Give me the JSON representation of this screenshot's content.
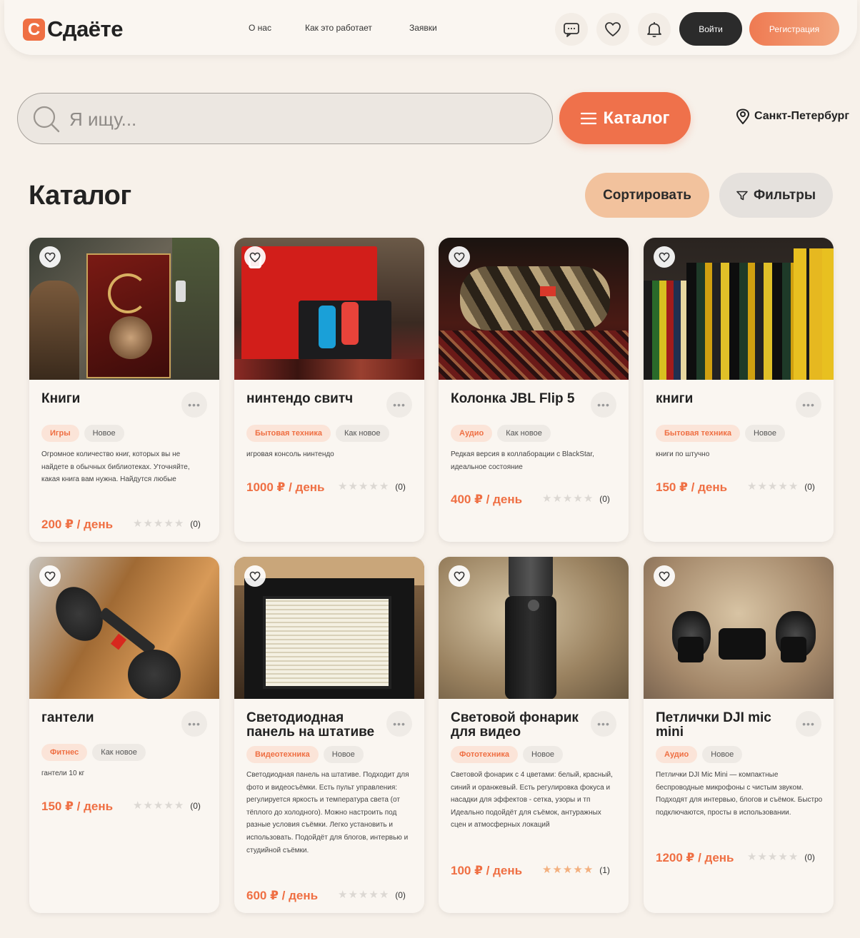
{
  "header": {
    "logo_mark": "С",
    "logo_text": "Сдаёте",
    "nav": [
      "О нас",
      "Как это работает",
      "Заявки"
    ],
    "login": "Войти",
    "register": "Регистрация"
  },
  "search": {
    "placeholder": "Я ищу...",
    "value": ""
  },
  "catalog_button": "Каталог",
  "location": "Санкт-Петербург",
  "page_title": "Каталог",
  "sort_button": "Сортировать",
  "filter_button": "Фильтры",
  "rating_max": 5,
  "cards": [
    {
      "title": "Книги",
      "category": "Игры",
      "condition": "Новое",
      "description": "Огромное количество книг, которых вы не найдете в обычных библиотеках. Уточняйте, какая книга вам нужна. Найдутся любые",
      "price": "200 ₽ / день",
      "rating": 0,
      "reviews": "(0)"
    },
    {
      "title": "нинтендо свитч",
      "category": "Бытовая техника",
      "condition": "Как новое",
      "description": "игровая консоль нинтендо",
      "price": "1000 ₽ / день",
      "rating": 0,
      "reviews": "(0)"
    },
    {
      "title": "Колонка JBL Flip 5",
      "category": "Аудио",
      "condition": "Как новое",
      "description": "Редкая версия в коллаборации с BlackStar, идеальное состояние",
      "price": "400 ₽ / день",
      "rating": 0,
      "reviews": "(0)"
    },
    {
      "title": "книги",
      "category": "Бытовая техника",
      "condition": "Новое",
      "description": "книги по штучно",
      "price": "150 ₽ / день",
      "rating": 0,
      "reviews": "(0)"
    },
    {
      "title": "гантели",
      "category": "Фитнес",
      "condition": "Как новое",
      "description": "гантели 10 кг",
      "price": "150 ₽ / день",
      "rating": 0,
      "reviews": "(0)"
    },
    {
      "title": "Светодиодная панель на штативе",
      "category": "Видеотехника",
      "condition": "Новое",
      "description": "Светодиодная панель на штативе. Подходит для фото и видеосъёмки. Есть пульт управления: регулируется яркость и температура света (от тёплого до холодного). Можно настроить под разные условия съёмки. Легко установить и использовать. Подойдёт для блогов, интервью и студийной съёмки.",
      "price": "600 ₽ / день",
      "rating": 0,
      "reviews": "(0)"
    },
    {
      "title": "Световой фонарик для видео",
      "category": "Фототехника",
      "condition": "Новое",
      "description": "Световой фонарик с 4 цветами: белый, красный, синий и оранжевый. Есть регулировка фокуса и насадки для эффектов - сетка, узоры и тп Идеально подойдёт для съёмок, антуражных сцен и атмосферных локаций",
      "price": "100 ₽ / день",
      "rating": 5,
      "reviews": "(1)"
    },
    {
      "title": "Петлички DJI mic mini",
      "category": "Аудио",
      "condition": "Новое",
      "description": "Петлички DJI Mic Mini — компактные беспроводные микрофоны с чистым звуком. Подходят для интервью, блогов и съёмок. Быстро подключаются, просты в использовании.",
      "price": "1200 ₽ / день",
      "rating": 0,
      "reviews": "(0)"
    }
  ],
  "colors": {
    "accent": "#ef6f43",
    "background": "#f7f1ea",
    "dark_button": "#2b2b2b",
    "sort_button": "#f2c29d",
    "star_on": "#f3b07f",
    "star_off": "#dcd8d3"
  },
  "icons": [
    "chat-icon",
    "heart-icon",
    "bell-icon",
    "search-icon",
    "burger-icon",
    "location-pin-icon",
    "filter-icon",
    "more-dots-icon"
  ]
}
